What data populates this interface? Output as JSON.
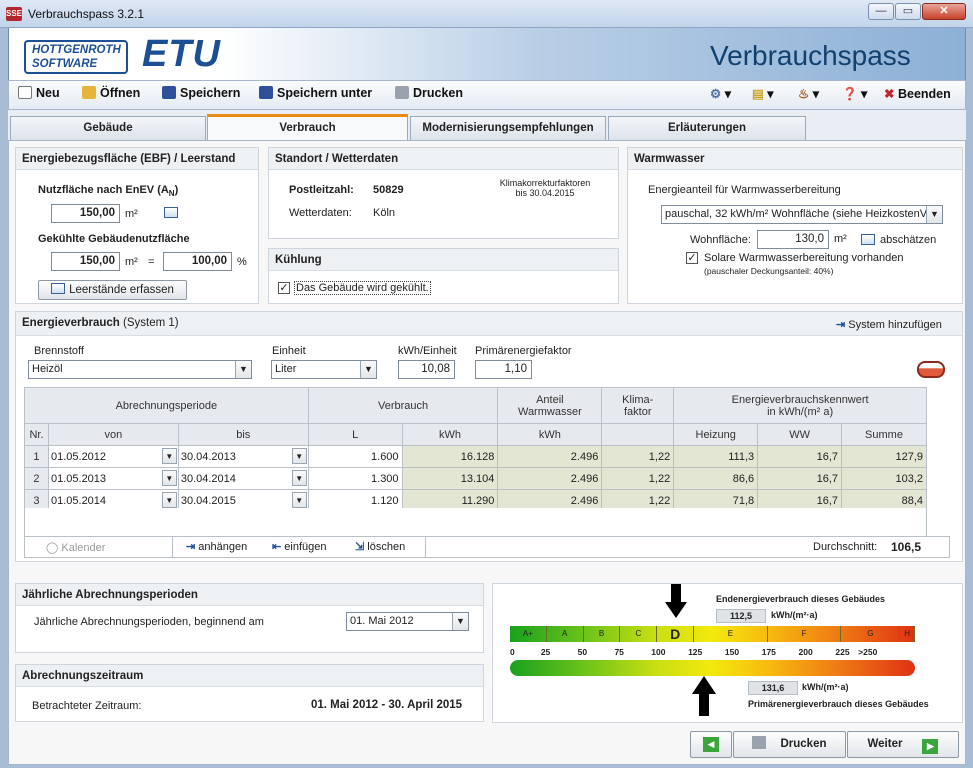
{
  "window": {
    "title": "Verbrauchspass 3.2.1",
    "icon_text": "SSE"
  },
  "banner": {
    "logo_line1": "HOTTGENROTH",
    "logo_line2": "SOFTWARE",
    "logo_etu": "ETU",
    "title": "Verbrauchspass"
  },
  "toolbar": {
    "new": "Neu",
    "open": "Öffnen",
    "save": "Speichern",
    "save_as": "Speichern unter",
    "print": "Drucken",
    "exit": "Beenden"
  },
  "tabs": [
    "Gebäude",
    "Verbrauch",
    "Modernisierungsempfehlungen",
    "Erläuterungen"
  ],
  "ebf": {
    "title": "Energiebezugsfläche (EBF) / Leerstand",
    "nutz_label": "Nutzfläche nach EnEV (A",
    "nutz_sub": "N",
    "nutz_close": ")",
    "nutz_value": "150,00",
    "unit_m2": "m²",
    "cool_label": "Gekühlte Gebäudenutzfläche",
    "cool_value": "150,00",
    "eq": "=",
    "pct_value": "100,00",
    "pct": "%",
    "leer_btn": "Leerstände erfassen"
  },
  "standort": {
    "title": "Standort / Wetterdaten",
    "plz_label": "Postleitzahl:",
    "plz_value": "50829",
    "wetter_label": "Wetterdaten:",
    "wetter_value": "Köln",
    "klima_line1": "Klimakorrekturfaktoren",
    "klima_line2": "bis 30.04.2015"
  },
  "kuehlung": {
    "title": "Kühlung",
    "check_label": "Das Gebäude wird gekühlt."
  },
  "warmwasser": {
    "title": "Warmwasser",
    "label": "Energieanteil für Warmwasserbereitung",
    "select": "pauschal, 32 kWh/m² Wohnfläche (siehe HeizkostenV)",
    "wohn_label": "Wohnfläche:",
    "wohn_value": "130,0",
    "unit": "m²",
    "estimate": "abschätzen",
    "solar_label": "Solare Warmwasserbereitung vorhanden",
    "solar_note": "(pauschaler Deckungsanteil: 40%)"
  },
  "verbrauch": {
    "title": "Energieverbrauch",
    "system": "(System 1)",
    "add_system": "System hinzufügen",
    "brennstoff_label": "Brennstoff",
    "brennstoff": "Heizöl",
    "einheit_label": "Einheit",
    "einheit": "Liter",
    "kwh_label": "kWh/Einheit",
    "kwh": "10,08",
    "pef_label": "Primärenergiefaktor",
    "pef": "1,10"
  },
  "grid": {
    "h_period": "Abrechnungsperiode",
    "h_verbrauch": "Verbrauch",
    "h_anteil1": "Anteil",
    "h_anteil2": "Warmwasser",
    "h_klima1": "Klima-",
    "h_klima2": "faktor",
    "h_kenn1": "Energieverbrauchskennwert",
    "h_kenn2": "in kWh/(m² a)",
    "s_nr": "Nr.",
    "s_von": "von",
    "s_bis": "bis",
    "s_l": "L",
    "s_kwh": "kWh",
    "s_kwh2": "kWh",
    "s_heiz": "Heizung",
    "s_ww": "WW",
    "s_sum": "Summe",
    "rows": [
      {
        "nr": "1",
        "von": "01.05.2012",
        "bis": "30.04.2013",
        "l": "1.600",
        "kwh": "16.128",
        "ww": "2.496",
        "klima": "1,22",
        "heiz": "111,3",
        "www": "16,7",
        "sum": "127,9"
      },
      {
        "nr": "2",
        "von": "01.05.2013",
        "bis": "30.04.2014",
        "l": "1.300",
        "kwh": "13.104",
        "ww": "2.496",
        "klima": "1,22",
        "heiz": "86,6",
        "www": "16,7",
        "sum": "103,2"
      },
      {
        "nr": "3",
        "von": "01.05.2014",
        "bis": "30.04.2015",
        "l": "1.120",
        "kwh": "11.290",
        "ww": "2.496",
        "klima": "1,22",
        "heiz": "71,8",
        "www": "16,7",
        "sum": "88,4"
      }
    ],
    "kalender": "Kalender",
    "append": "anhängen",
    "insert": "einfügen",
    "delete": "löschen",
    "avg_label": "Durchschnitt:",
    "avg_value": "106,5"
  },
  "jaehrlich": {
    "title": "Jährliche Abrechnungsperioden",
    "label": "Jährliche Abrechnungsperioden, beginnend am",
    "value": "01. Mai 2012"
  },
  "zeitraum": {
    "title": "Abrechnungszeitraum",
    "label": "Betrachteter Zeitraum:",
    "value": "01. Mai 2012 - 30. April 2015"
  },
  "scale": {
    "end_label": "Endenergieverbrauch dieses Gebäudes",
    "end_value": "112,5",
    "unit": "kWh/(m²·a)",
    "prim_label": "Primärenergieverbrauch dieses Gebäudes",
    "prim_value": "131,6",
    "classes": [
      "A+",
      "A",
      "B",
      "C",
      "D",
      "E",
      "F",
      "G",
      "H"
    ],
    "ticks": [
      "0",
      "25",
      "50",
      "75",
      "100",
      "125",
      "150",
      "175",
      "200",
      "225",
      ">250"
    ],
    "end_numeric": 112.5,
    "prim_numeric": 131.6
  },
  "nav": {
    "print": "Drucken",
    "next": "Weiter"
  }
}
